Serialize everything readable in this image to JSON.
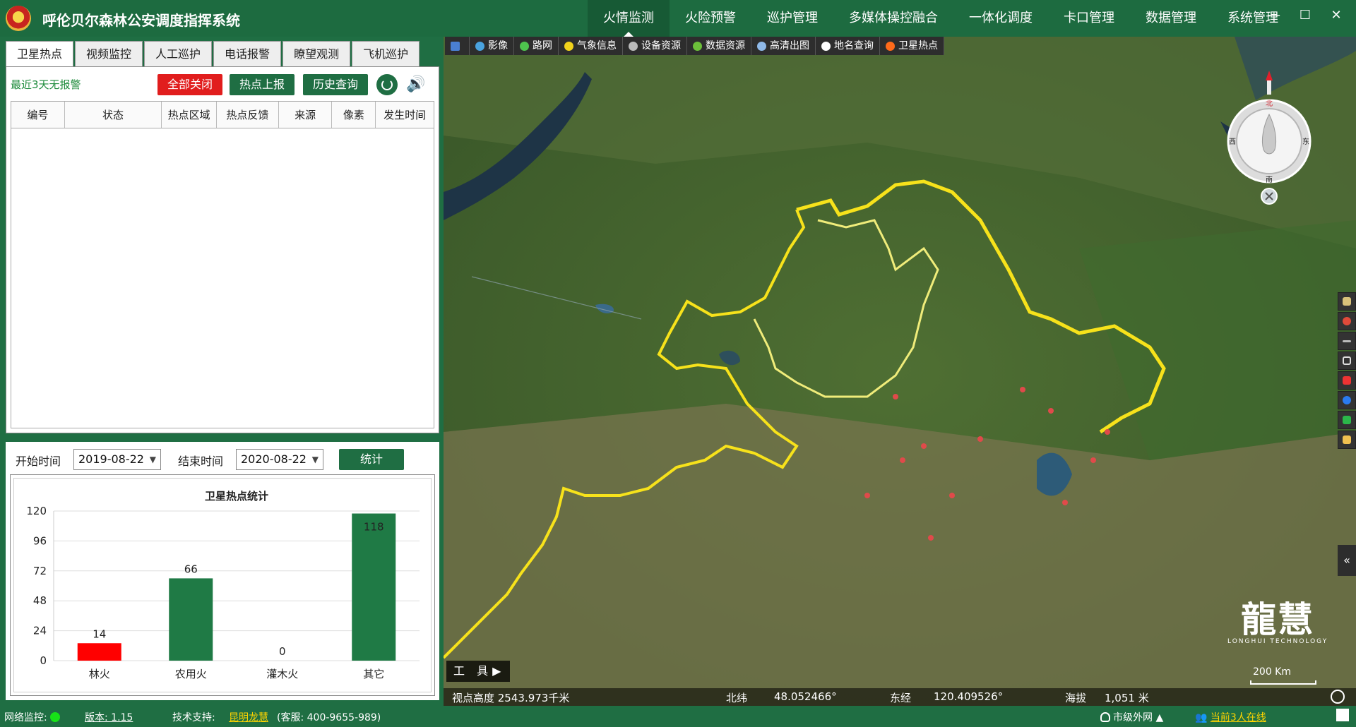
{
  "app": {
    "title": "呼伦贝尔森林公安调度指挥系统"
  },
  "nav": {
    "items": [
      "火情监测",
      "火险预警",
      "巡护管理",
      "多媒体操控融合",
      "一体化调度",
      "卡口管理",
      "数据管理",
      "系统管理"
    ],
    "active_index": 0
  },
  "window_controls": {
    "minimize": "—",
    "maximize": "☐",
    "close": "✕"
  },
  "left_tabs": [
    "卫星热点",
    "视频监控",
    "人工巡护",
    "电话报警",
    "瞭望观测",
    "飞机巡护"
  ],
  "hotspot_panel": {
    "alarm_text": "最近3天无报警",
    "btn_close_all": "全部关闭",
    "btn_report": "热点上报",
    "btn_history": "历史查询",
    "columns": [
      "编号",
      "状态",
      "热点区域",
      "热点反馈",
      "来源",
      "像素",
      "发生时间"
    ]
  },
  "stats_panel": {
    "start_label": "开始时间",
    "start_value": "2019-08-22",
    "end_label": "结束时间",
    "end_value": "2020-08-22",
    "btn_stat": "统计"
  },
  "chart_data": {
    "type": "bar",
    "title": "卫星热点统计",
    "categories": [
      "林火",
      "农用火",
      "灌木火",
      "其它"
    ],
    "values": [
      14,
      66,
      0,
      118
    ],
    "colors": [
      "#ff0000",
      "#1f7a45",
      "#1f7a45",
      "#1f7a45"
    ],
    "ylim": [
      0,
      120
    ],
    "yticks": [
      0,
      24,
      48,
      72,
      96,
      120
    ],
    "grid": true
  },
  "map_toolbar": [
    {
      "label": "影像",
      "icon": "globe-icon",
      "color": "#4aa3df"
    },
    {
      "label": "路网",
      "icon": "road-icon",
      "color": "#4ec34e"
    },
    {
      "label": "气象信息",
      "icon": "sun-icon",
      "color": "#f2d21b"
    },
    {
      "label": "设备资源",
      "icon": "device-icon",
      "color": "#bbbbbb"
    },
    {
      "label": "数据资源",
      "icon": "tree-icon",
      "color": "#6cbf3a"
    },
    {
      "label": "高清出图",
      "icon": "image-icon",
      "color": "#8fb9e8"
    },
    {
      "label": "地名查询",
      "icon": "search-icon",
      "color": "#ffffff"
    },
    {
      "label": "卫星热点",
      "icon": "fire-icon",
      "color": "#ff6a1a"
    }
  ],
  "compass": {
    "north": "北",
    "south": "南",
    "east": "东",
    "west": "西"
  },
  "map_overlay": {
    "tools_label": "工 具",
    "scale_label": "200 Km",
    "brand_big": "龍慧",
    "brand_small": "LONGHUI TECHNOLOGY",
    "collapse": "«"
  },
  "map_status": {
    "altitude": "视点高度  2543.973千米",
    "lat_label": "北纬",
    "lat_value": "48.052466°",
    "lon_label": "东经",
    "lon_value": "120.409526°",
    "elev_label": "海拔",
    "elev_value": "1,051 米"
  },
  "statusbar": {
    "net_label": "网络监控:",
    "version": "版本: 1.15",
    "support_label": "技术支持:",
    "support_link": "昆明龙慧",
    "service": "(客服: 400-9655-989)",
    "network": "市级外网",
    "online": "当前3人在线"
  }
}
